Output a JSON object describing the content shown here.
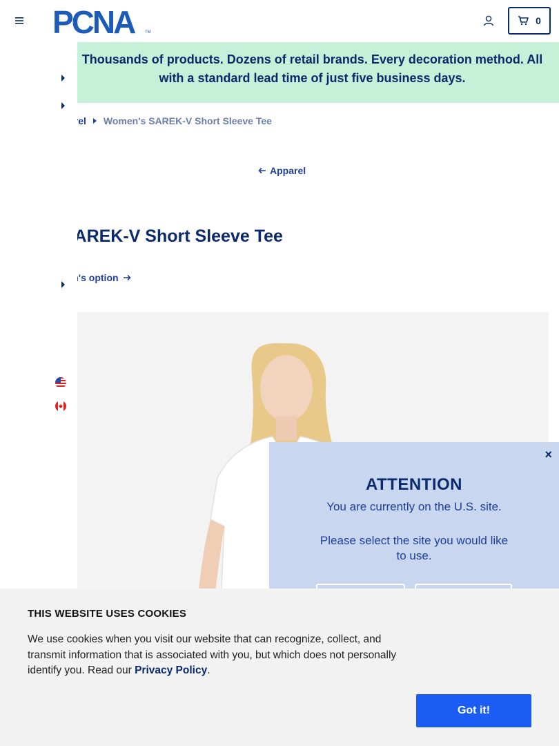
{
  "header": {
    "logo_text": "PCNA",
    "logo_tm": "TM",
    "cart_count": "0",
    "menu_icon": "hamburger-icon",
    "account_icon": "user-icon",
    "cart_icon": "cart-icon"
  },
  "banner": {
    "text": "Thousands of products. Dozens of retail brands. Every decoration method. All with a standard lead time of just five business days."
  },
  "breadcrumb": {
    "parent": "arel",
    "current": "Women's SAREK-V Short Sleeve Tee"
  },
  "back_link": "Apparel",
  "product": {
    "title": "s SAREK-V Short Sleeve Tee",
    "option_link": "men's option"
  },
  "attention": {
    "title": "ATTENTION",
    "line1": "You are currently on the U.S. site.",
    "line2": "Please select the site you would like to use.",
    "close": "×"
  },
  "cookie": {
    "title": "THIS WEBSITE USES COOKIES",
    "text_before": "We use cookies when you visit our website that can recognize, collect, and transmit information that is associated with you, but which does not personally identify you. Read our ",
    "link": "Privacy Policy",
    "text_after": ".",
    "button": "Got it!"
  },
  "colors": {
    "navy": "#0b2a6b",
    "link_blue": "#1f3f9a",
    "banner_green": "#c7f0d8",
    "modal_blue": "#c9d6ef",
    "cookie_btn": "#1b5cf5"
  }
}
